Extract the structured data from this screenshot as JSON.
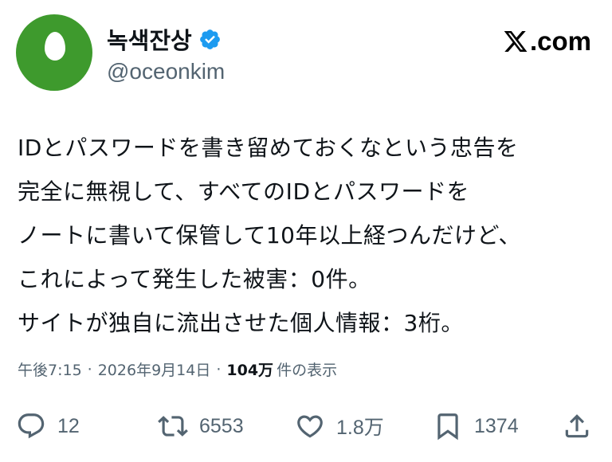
{
  "user": {
    "display_name": "녹색잔상",
    "handle": "@oceonkim",
    "verified": true,
    "avatar": "green-egg-avatar"
  },
  "brand": {
    "logo": "x-logo",
    "text": ".com"
  },
  "tweet": {
    "lines": [
      "IDとパスワードを書き留めておくなという忠告を",
      "完全に無視して、すべてのIDとパスワードを",
      "ノートに書いて保管して10年以上経つんだけど、",
      "これによって発生した被害：0件。",
      "サイトが独自に流出させた個人情報：3桁。"
    ]
  },
  "meta": {
    "time": "午後7:15",
    "separator": "·",
    "date": "2026年9月14日",
    "views_count": "104万",
    "views_label": "件の表示"
  },
  "actions": {
    "reply": {
      "icon": "reply-icon",
      "count": "12"
    },
    "retweet": {
      "icon": "retweet-icon",
      "count": "6553"
    },
    "like": {
      "icon": "heart-icon",
      "count": "1.8万"
    },
    "bookmark": {
      "icon": "bookmark-icon",
      "count": "1374"
    },
    "share": {
      "icon": "share-icon"
    }
  },
  "colors": {
    "avatar_bg": "#3e9a2d",
    "verified": "#1d9bf0",
    "text_primary": "#0f1419",
    "text_secondary": "#536471"
  }
}
